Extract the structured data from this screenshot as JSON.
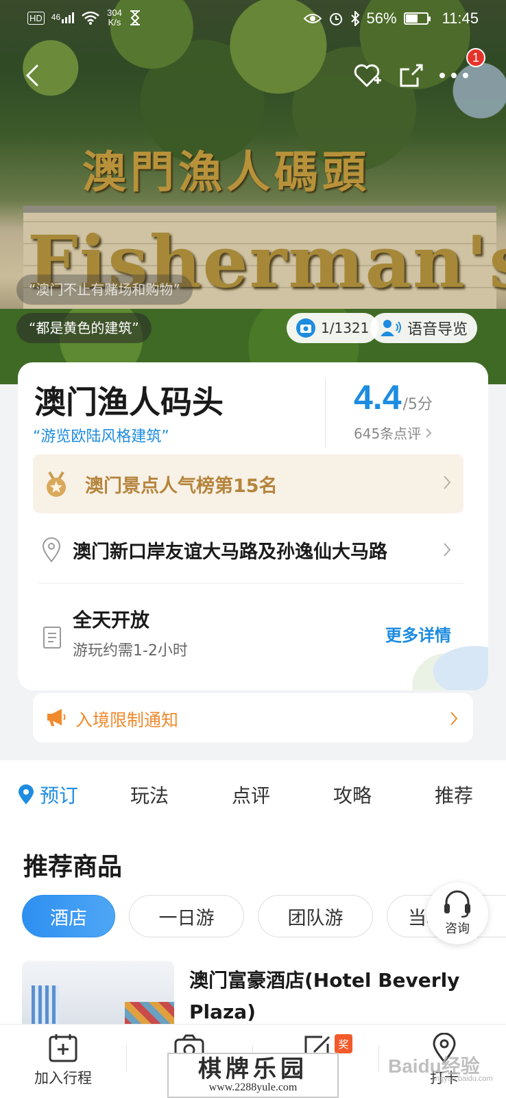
{
  "status_bar": {
    "hd": "HD",
    "signal": "46",
    "speed_value": "304",
    "speed_unit": "K/s",
    "battery": "56%",
    "battery_level": 0.56,
    "time": "11:45"
  },
  "header": {
    "badge_count": "1"
  },
  "hero": {
    "photo_sign_cn": "澳門漁人碼頭",
    "photo_sign_en": "Fisherman's W",
    "quote_1": "“澳门不止有赌场和购物”",
    "quote_2": "“都是黄色的建筑”",
    "photo_counter": "1/1321",
    "audio_guide": "语音导览"
  },
  "poi": {
    "title": "澳门渔人码头",
    "subtitle": "“游览欧陆风格建筑”",
    "score": "4.4",
    "score_unit": "/5分",
    "review_count": "645条点评",
    "rank": "澳门景点人气榜第15名",
    "address": "澳门新口岸友谊大马路及孙逸仙大马路",
    "hours": "全天开放",
    "duration": "游玩约需1-2小时",
    "more_details": "更多详情",
    "notice": "入境限制通知"
  },
  "tabs": [
    "预订",
    "玩法",
    "点评",
    "攻略",
    "推荐"
  ],
  "products": {
    "section_title": "推荐商品",
    "filters": [
      "酒店",
      "一日游",
      "团队游",
      "当地向导"
    ],
    "consult": "咨询",
    "hotel_name": "澳门富豪酒店(Hotel Beverly Plaza)"
  },
  "bottom_bar": {
    "items": [
      "加入行程",
      "",
      "",
      "打卡"
    ],
    "reward_badge": "奖"
  },
  "watermark": {
    "main": "棋牌乐园",
    "url": "www.2288yule.com",
    "baidu": "Baidu经验",
    "baidu_url": "jingyan.baidu.com"
  },
  "colors": {
    "accent": "#1d8ce0",
    "rank_text": "#b5853d",
    "notice": "#f08a2c",
    "badge": "#e6332a"
  }
}
